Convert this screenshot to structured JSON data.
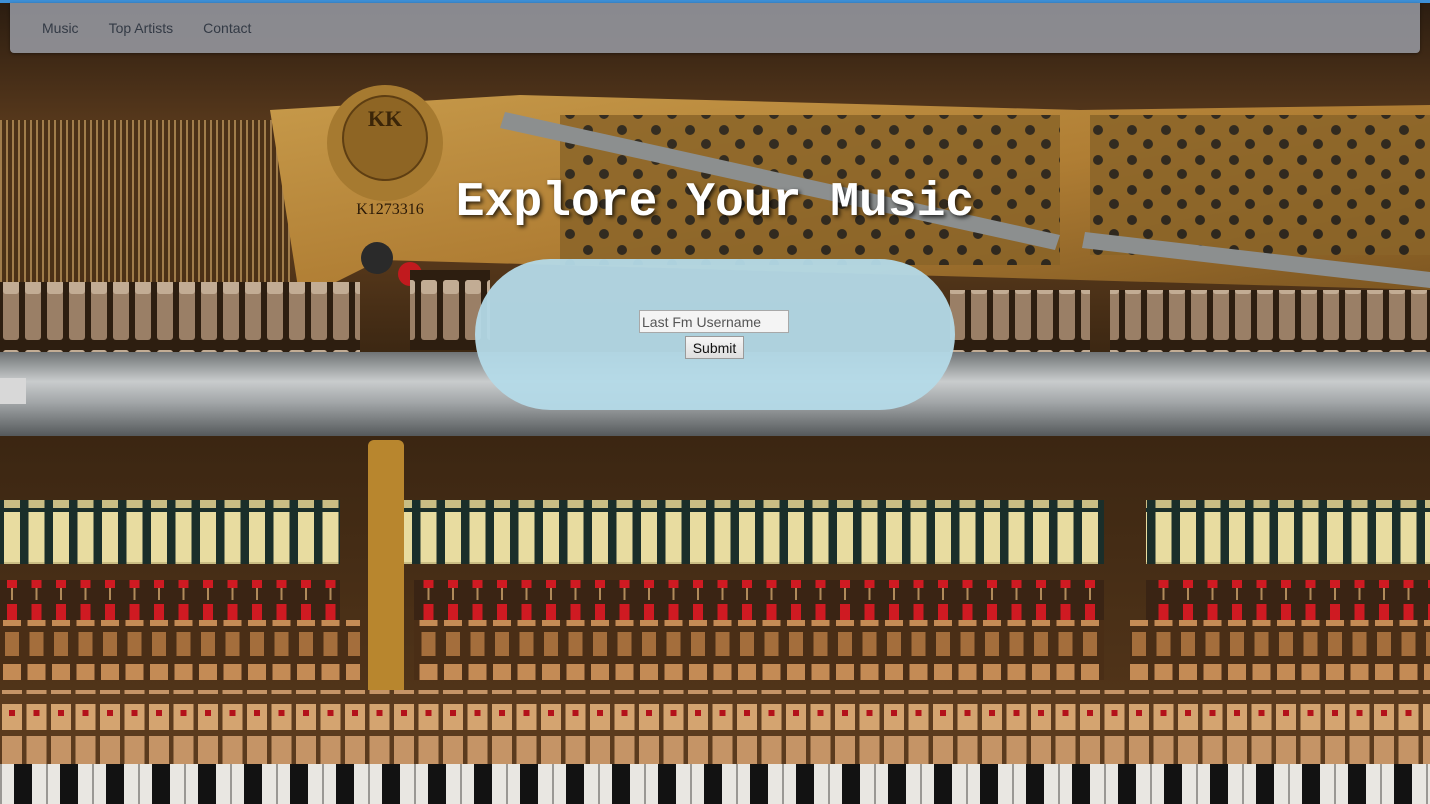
{
  "nav": {
    "items": [
      {
        "label": "Music"
      },
      {
        "label": "Top Artists"
      },
      {
        "label": "Contact"
      }
    ]
  },
  "hero": {
    "title": "Explore Your Music"
  },
  "form": {
    "username_placeholder": "Last Fm Username",
    "username_value": "",
    "submit_label": "Submit"
  },
  "background": {
    "plate_text": "K1273316",
    "logo_text": "KK"
  },
  "colors": {
    "accent_bar": "#3d8fd6",
    "navbar": "#9698a0",
    "form_pill": "#b4dae8",
    "title": "#ffffff",
    "hammer_red": "#c8141c"
  }
}
